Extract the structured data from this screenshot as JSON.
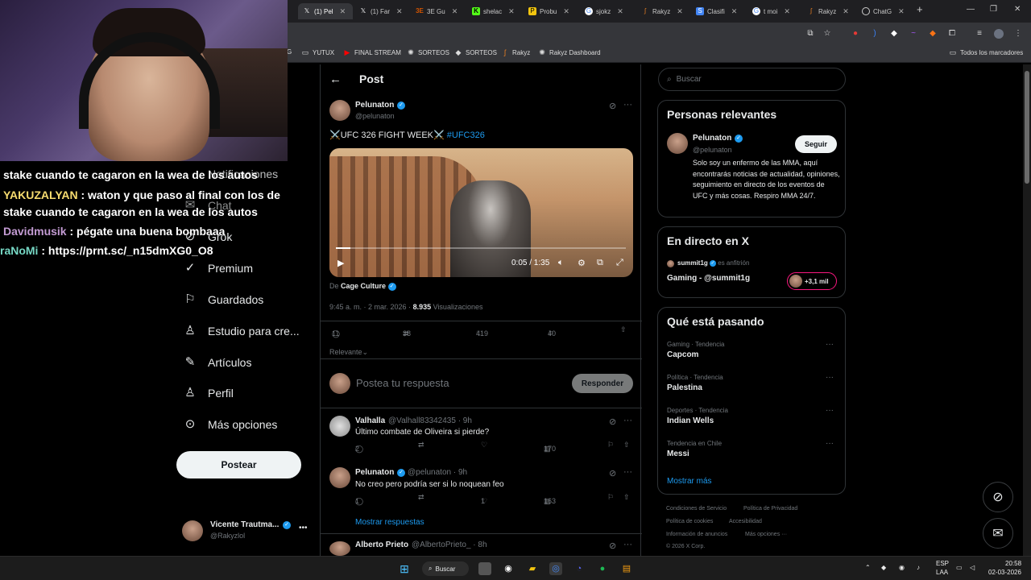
{
  "tabs": [
    {
      "label": "(1) Pel",
      "icon": "X",
      "color": "#000000",
      "active": true
    },
    {
      "label": "(1) Far",
      "icon": "X",
      "color": "#000000"
    },
    {
      "label": "3E Gu",
      "icon": "3E",
      "color": "#d35400"
    },
    {
      "label": "shelac",
      "icon": "K",
      "color": "#53fc18"
    },
    {
      "label": "Probu",
      "icon": "P",
      "color": "#f1c40f"
    },
    {
      "label": "sjokz",
      "icon": "G",
      "color": "#ffffff"
    },
    {
      "label": "Rakyz",
      "icon": "R",
      "color": "#e67e22"
    },
    {
      "label": "Clasifi",
      "icon": "S",
      "color": "#4285f4"
    },
    {
      "label": "t moi",
      "icon": "G",
      "color": "#ffffff"
    },
    {
      "label": "Rakyz",
      "icon": "R",
      "color": "#e67e22"
    },
    {
      "label": "ChatG",
      "icon": "C",
      "color": "#ffffff"
    }
  ],
  "bookmarks": [
    {
      "label": "G",
      "icon": ""
    },
    {
      "label": "YUTUX",
      "icon": "folder-icon"
    },
    {
      "label": "FINAL STREAM",
      "icon": "youtube-icon"
    },
    {
      "label": "SORTEOS",
      "icon": "gear-icon"
    },
    {
      "label": "SORTEOS",
      "icon": "diamond-icon"
    },
    {
      "label": "Rakyz",
      "icon": "rakyz-icon"
    },
    {
      "label": "Rakyz Dashboard",
      "icon": "gear-icon"
    }
  ],
  "bookmarks_all": "Todos los marcadores",
  "chat": [
    {
      "user": "YAKUZALYAN",
      "text": " : waton y que paso al final con los de",
      "color": "#f7dc6f"
    },
    {
      "user": "",
      "text": "stake cuando te cagaron en la wea de los autos",
      "color": "#ffffff"
    },
    {
      "user": "Davidmusik",
      "text": " : pégate una buena bombaaa",
      "color": "#c39bd3"
    },
    {
      "user": "raNoMi",
      "text": " : https://prnt.sc/_n15dmXG0_O8",
      "color": "#76d7c4"
    }
  ],
  "chat_partial_top": "stake cuando te cagaron en la wea de los autos",
  "nav": {
    "notificaciones": "Notificaciones",
    "chat": "Chat",
    "grok": "Grok",
    "premium": "Premium",
    "guardados": "Guardados",
    "estudio": "Estudio para cre...",
    "articulos": "Artículos",
    "perfil": "Perfil",
    "mas": "Más opciones",
    "postear": "Postear"
  },
  "account": {
    "name": "Vicente Trautma...",
    "handle": "@Rakyzlol"
  },
  "post": {
    "header": "Post",
    "author": "Pelunaton",
    "handle": "@pelunaton",
    "text_prefix": "⚔️UFC 326 FIGHT WEEK⚔️ ",
    "hashtag": "#UFC326",
    "video_time": "0:05 / 1:35",
    "video_progress": 0.05,
    "source_prefix": "De ",
    "source": "Cage Culture",
    "timestamp": "9:45 a. m. · 2 mar. 2026 · ",
    "views": "8.935",
    "views_label": " Visualizaciones",
    "replies": "11",
    "reposts": "38",
    "likes": "419",
    "bookmarks": "40",
    "sort": "Relevante",
    "reply_placeholder": "Postea tu respuesta",
    "reply_button": "Responder"
  },
  "replies": [
    {
      "name": "Valhalla",
      "handle": "@Valhall83342435 · 9h",
      "text": "Último combate de Oliveira si pierde?",
      "replies": "2",
      "reposts": "",
      "likes": "",
      "views": "170"
    },
    {
      "name": "Pelunaton",
      "handle": "@pelunaton · 9h",
      "text": "No creo pero podría ser si lo noquean feo",
      "replies": "1",
      "reposts": "",
      "likes": "1",
      "views": "163"
    },
    {
      "name": "Alberto Prieto",
      "handle": "@AlbertoPrieto_ · 8h"
    }
  ],
  "show_replies": "Mostrar respuestas",
  "search_placeholder": "Buscar",
  "relevant": {
    "title": "Personas relevantes",
    "name": "Pelunaton",
    "handle": "@pelunaton",
    "follow": "Seguir",
    "bio": "Solo soy un enfermo de las MMA, aquí encontrarás noticias de actualidad, opiniones, seguimiento en directo de los eventos de UFC y más cosas. Respiro MMA 24/7."
  },
  "live": {
    "title": "En directo en X",
    "host": "summit1g",
    "host_suffix": " es anfitrión",
    "stream": "Gaming - @summit1g",
    "listeners": "+3,1 mil"
  },
  "trending": {
    "title": "Qué está pasando",
    "items": [
      {
        "category": "Gaming · Tendencia",
        "name": "Capcom"
      },
      {
        "category": "Política · Tendencia",
        "name": "Palestina"
      },
      {
        "category": "Deportes · Tendencia",
        "name": "Indian Wells"
      },
      {
        "category": "Tendencia en Chile",
        "name": "Messi"
      }
    ],
    "more": "Mostrar más"
  },
  "footer": [
    "Condiciones de Servicio",
    "Política de Privacidad",
    "Política de cookies",
    "Accesibilidad",
    "Información de anuncios",
    "Más opciones ···",
    "© 2026 X Corp."
  ],
  "taskbar": {
    "search": "Buscar",
    "lang1": "ESP",
    "lang2": "LAA",
    "time": "20:58",
    "date": "02-03-2026"
  }
}
